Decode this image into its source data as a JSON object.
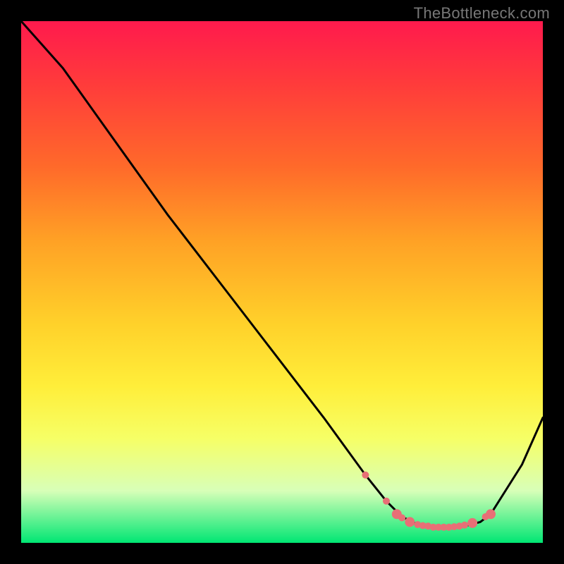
{
  "watermark": "TheBottleneck.com",
  "chart_data": {
    "type": "line",
    "title": "",
    "xlabel": "",
    "ylabel": "",
    "xlim": [
      0,
      100
    ],
    "ylim": [
      0,
      100
    ],
    "series": [
      {
        "name": "bottleneck-curve",
        "color": "#000000",
        "x": [
          0,
          8,
          18,
          28,
          38,
          48,
          58,
          66,
          70,
          73,
          76,
          79,
          82,
          85,
          88,
          90,
          96,
          100
        ],
        "y": [
          100,
          91,
          77,
          63,
          50,
          37,
          24,
          13,
          8,
          5,
          3.5,
          3,
          3,
          3.2,
          4,
          5.5,
          15,
          24
        ]
      }
    ],
    "markers": {
      "name": "highlight-dots",
      "color": "#e86f76",
      "radius_small": 5,
      "radius_large": 7,
      "points": [
        {
          "x": 66,
          "y": 13,
          "r": "small"
        },
        {
          "x": 70,
          "y": 8,
          "r": "small"
        },
        {
          "x": 72,
          "y": 5.5,
          "r": "large"
        },
        {
          "x": 73,
          "y": 4.8,
          "r": "small"
        },
        {
          "x": 74.5,
          "y": 4.0,
          "r": "large"
        },
        {
          "x": 76,
          "y": 3.5,
          "r": "small"
        },
        {
          "x": 77,
          "y": 3.3,
          "r": "small"
        },
        {
          "x": 78,
          "y": 3.2,
          "r": "small"
        },
        {
          "x": 79,
          "y": 3.0,
          "r": "small"
        },
        {
          "x": 80,
          "y": 3.0,
          "r": "small"
        },
        {
          "x": 81,
          "y": 3.0,
          "r": "small"
        },
        {
          "x": 82,
          "y": 3.0,
          "r": "small"
        },
        {
          "x": 83,
          "y": 3.1,
          "r": "small"
        },
        {
          "x": 84,
          "y": 3.2,
          "r": "small"
        },
        {
          "x": 85,
          "y": 3.4,
          "r": "small"
        },
        {
          "x": 86.5,
          "y": 3.8,
          "r": "large"
        },
        {
          "x": 89,
          "y": 5.0,
          "r": "small"
        },
        {
          "x": 90,
          "y": 5.5,
          "r": "large"
        }
      ]
    }
  }
}
